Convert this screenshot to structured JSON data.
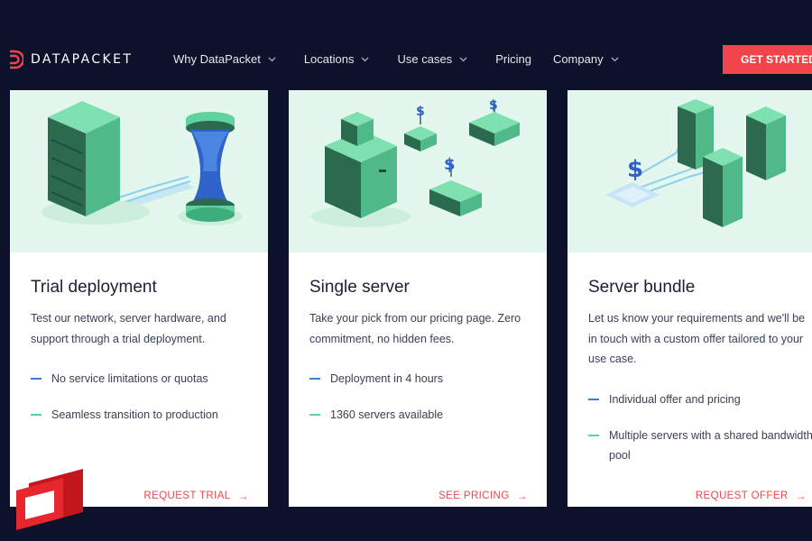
{
  "brand": {
    "name": "DATAPACKET"
  },
  "nav": {
    "items": [
      {
        "label": "Why DataPacket",
        "dropdown": true
      },
      {
        "label": "Locations",
        "dropdown": true
      },
      {
        "label": "Use cases",
        "dropdown": true
      },
      {
        "label": "Pricing",
        "dropdown": false
      },
      {
        "label": "Company",
        "dropdown": true
      }
    ],
    "cta": "GET STARTED"
  },
  "cards": [
    {
      "title": "Trial deployment",
      "description": "Test our network, server hardware, and support through a trial deployment.",
      "bullets": [
        "No service limitations or quotas",
        "Seamless transition to production"
      ],
      "link": "REQUEST TRIAL"
    },
    {
      "title": "Single server",
      "description": "Take your pick from our pricing page. Zero commitment, no hidden fees.",
      "bullets": [
        "Deployment in 4 hours",
        "1360 servers available"
      ],
      "link": "SEE PRICING"
    },
    {
      "title": "Server bundle",
      "description": "Let us know your requirements and we'll be in touch with a custom offer tailored to your use case.",
      "bullets": [
        "Individual offer and pricing",
        "Multiple servers with a shared bandwidth pool"
      ],
      "link": "REQUEST OFFER"
    }
  ],
  "colors": {
    "background": "#0d1129",
    "accent": "#f2444a",
    "illustration_bg": "#e3f7ee",
    "bullet_blue": "#3d7fd1",
    "bullet_green": "#5fd39e"
  },
  "icons": {
    "logo": "datapacket-logo-icon",
    "chevron": "chevron-down-icon",
    "arrow": "arrow-right-icon",
    "watermark": "channel-logo-icon"
  }
}
